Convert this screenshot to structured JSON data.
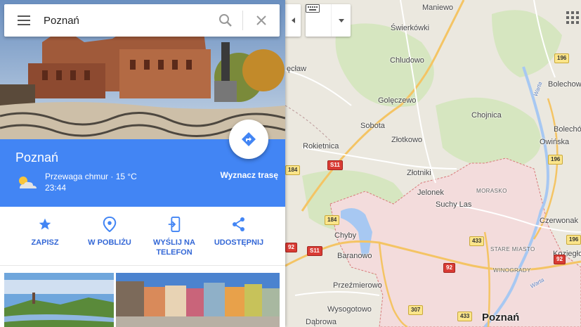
{
  "search": {
    "value": "Poznań"
  },
  "place": {
    "title": "Poznań",
    "weather_condition": "Przewaga chmur · 15 °C",
    "weather_time": "23:44",
    "route_label": "Wyznacz trasę"
  },
  "actions": [
    {
      "label": "ZAPISZ",
      "icon": "star-icon"
    },
    {
      "label": "W POBLIŻU",
      "icon": "nearby-pin-icon"
    },
    {
      "label": "WYŚLIJ NA TELEFON",
      "icon": "send-to-phone-icon"
    },
    {
      "label": "UDOSTĘPNIJ",
      "icon": "share-icon"
    }
  ],
  "map": {
    "places": [
      "Maniewo",
      "Świerkówki",
      "Chludowo",
      "Golęczewo",
      "Sobota",
      "Złotkowo",
      "Chojnica",
      "Rokietnica",
      "Złotniki",
      "Jelonek",
      "Suchy Las",
      "Chyby",
      "Baranowo",
      "Przeźmierowo",
      "Wysogotowo",
      "Dąbrowa",
      "Bolechowo",
      "Bolechó",
      "Owińska",
      "Czerwonak",
      "Koziegło",
      "ęcław"
    ],
    "districts": [
      "MORASKO",
      "STARE MIASTO",
      "WINOGRADY"
    ],
    "city": "Poznań",
    "river": "Warta",
    "roads": [
      "S11",
      "S11",
      "184",
      "184",
      "92",
      "92",
      "92",
      "433",
      "433",
      "307",
      "196",
      "196",
      "196"
    ],
    "colors": {
      "city_area": "#f5dfe0",
      "forest": "#cfe3b6",
      "water": "#a7c8f2",
      "accent": "#4285f4",
      "motorway": "#f4b745"
    }
  }
}
